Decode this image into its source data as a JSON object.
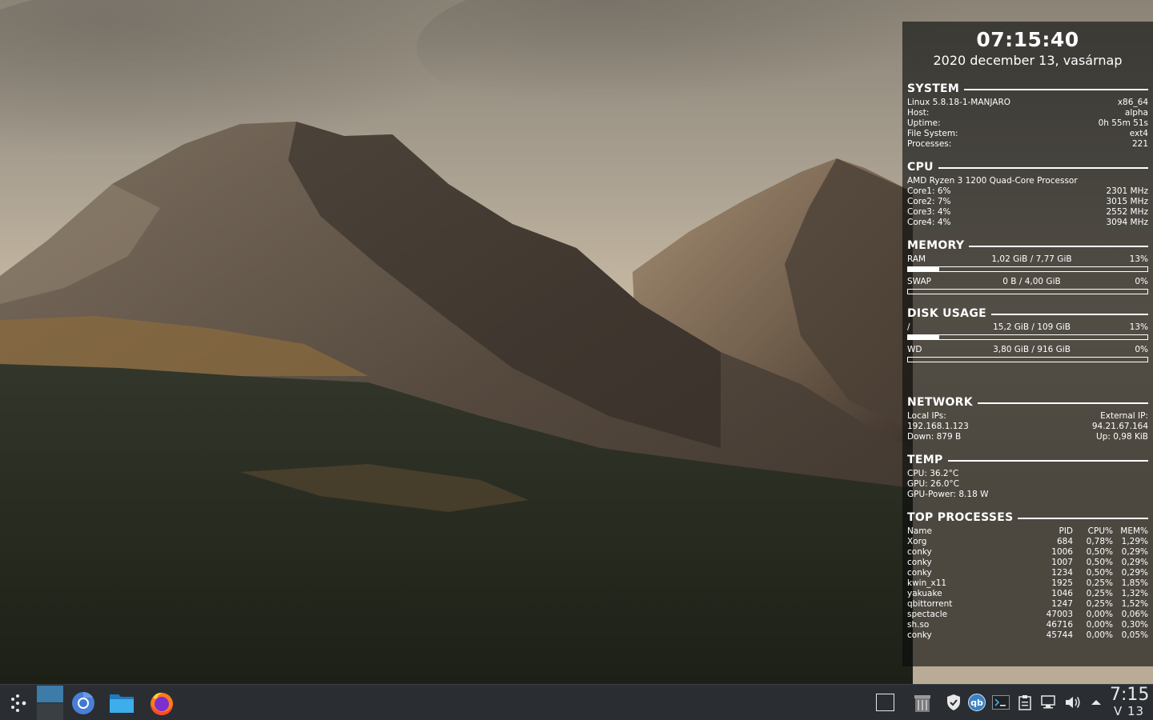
{
  "clock": {
    "time": "07:15:40",
    "date": "2020 december 13, vasárnap"
  },
  "system": {
    "title": "SYSTEM",
    "rows": [
      {
        "label": "Linux 5.8.18-1-MANJARO",
        "value": "x86_64"
      },
      {
        "label": "Host:",
        "value": "alpha"
      },
      {
        "label": "Uptime:",
        "value": "0h 55m 51s"
      },
      {
        "label": "File System:",
        "value": "ext4"
      },
      {
        "label": "Processes:",
        "value": "221"
      }
    ]
  },
  "cpu": {
    "title": "CPU",
    "model": "AMD Ryzen 3 1200 Quad-Core Processor",
    "cores": [
      {
        "label": "Core1: 6%",
        "value": "2301 MHz"
      },
      {
        "label": "Core2: 7%",
        "value": "3015 MHz"
      },
      {
        "label": "Core3: 4%",
        "value": "2552 MHz"
      },
      {
        "label": "Core4: 4%",
        "value": "3094 MHz"
      }
    ]
  },
  "memory": {
    "title": "MEMORY",
    "items": [
      {
        "label": "RAM",
        "value": "1,02 GiB / 7,77 GiB",
        "percent": "13%",
        "fraction": 0.13
      },
      {
        "label": "SWAP",
        "value": "0 B / 4,00 GiB",
        "percent": "0%",
        "fraction": 0
      }
    ]
  },
  "disk": {
    "title": "DISK USAGE",
    "items": [
      {
        "label": "/",
        "value": "15,2 GiB / 109 GiB",
        "percent": "13%",
        "fraction": 0.13
      },
      {
        "label": "WD",
        "value": "3,80 GiB / 916 GiB",
        "percent": "0%",
        "fraction": 0
      }
    ]
  },
  "network": {
    "title": "NETWORK",
    "local_label": "Local IPs:",
    "external_label": "External IP:",
    "local_ip": "192.168.1.123",
    "external_ip": "94.21.67.164",
    "down": "Down:  879 B",
    "up": "Up:  0,98 KiB"
  },
  "temp": {
    "title": "TEMP",
    "rows": [
      "CPU: 36.2°C",
      "GPU: 26.0°C",
      "GPU-Power: 8.18 W"
    ]
  },
  "processes": {
    "title": "TOP PROCESSES",
    "header": {
      "name": "Name",
      "pid": "PID",
      "cpu": "CPU%",
      "mem": "MEM%"
    },
    "rows": [
      {
        "name": "Xorg",
        "pid": "684",
        "cpu": "0,78%",
        "mem": "1,29%"
      },
      {
        "name": "conky",
        "pid": "1006",
        "cpu": "0,50%",
        "mem": "0,29%"
      },
      {
        "name": "conky",
        "pid": "1007",
        "cpu": "0,50%",
        "mem": "0,29%"
      },
      {
        "name": "conky",
        "pid": "1234",
        "cpu": "0,50%",
        "mem": "0,29%"
      },
      {
        "name": "kwin_x11",
        "pid": "1925",
        "cpu": "0,25%",
        "mem": "1,85%"
      },
      {
        "name": "yakuake",
        "pid": "1046",
        "cpu": "0,25%",
        "mem": "1,32%"
      },
      {
        "name": "qbittorrent",
        "pid": "1247",
        "cpu": "0,25%",
        "mem": "1,52%"
      },
      {
        "name": "spectacle",
        "pid": "47003",
        "cpu": "0,00%",
        "mem": "0,06%"
      },
      {
        "name": "sh.so",
        "pid": "46716",
        "cpu": "0,00%",
        "mem": "0,30%"
      },
      {
        "name": "conky",
        "pid": "45744",
        "cpu": "0,00%",
        "mem": "0,05%"
      }
    ]
  },
  "taskbar": {
    "launchers": [
      "app-launcher-icon",
      "pager",
      "chromium-icon",
      "file-manager-icon",
      "firefox-icon"
    ],
    "tray": [
      "show-desktop-icon",
      "trash-icon",
      "shield-icon",
      "qbittorrent-tray-icon",
      "terminal-icon",
      "clipboard-icon",
      "network-icon",
      "volume-icon",
      "tray-expand-icon"
    ],
    "qb_text": "qb",
    "clock_time": "7:15",
    "clock_date": "V 13"
  },
  "colors": {
    "panel_bg": "#2a2e32",
    "accent": "#3daee9",
    "conky_text": "#ffffff"
  }
}
